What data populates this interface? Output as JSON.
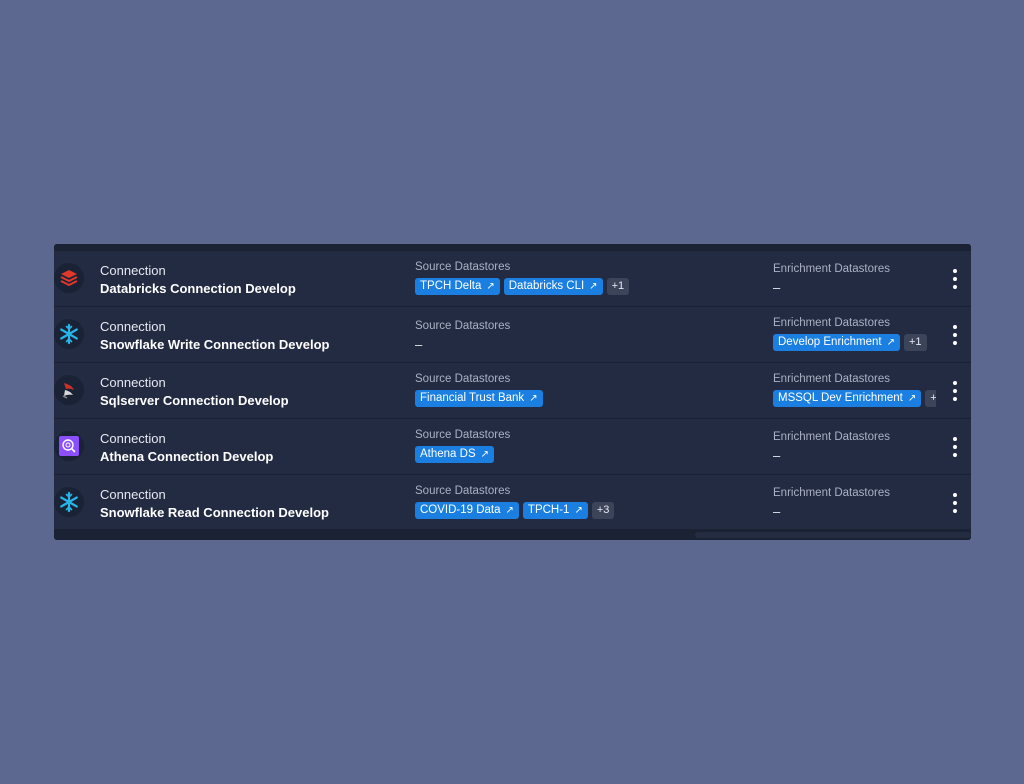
{
  "rows": [
    {
      "logo": "databricks-logo",
      "type": "Connection",
      "name": "Databricks Connection Develop",
      "source_label": "Source Datastores",
      "sources": [
        "TPCH Delta",
        "Databricks CLI"
      ],
      "sources_more": "+1",
      "enrichment_label": "Enrichment Datastores",
      "enrichment_empty": "–"
    },
    {
      "logo": "snowflake-logo",
      "type": "Connection",
      "name": "Snowflake Write Connection Develop",
      "source_label": "Source Datastores",
      "source_empty": "–",
      "enrichment_label": "Enrichment Datastores",
      "enrichments": [
        "Develop Enrichment"
      ],
      "enrichments_more": "+1"
    },
    {
      "logo": "sqlserver-logo",
      "type": "Connection",
      "name": "Sqlserver Connection Develop",
      "source_label": "Source Datastores",
      "sources": [
        "Financial Trust Bank"
      ],
      "enrichment_label": "Enrichment Datastores",
      "enrichments": [
        "MSSQL Dev Enrichment"
      ],
      "enrichments_more": "+"
    },
    {
      "logo": "athena-logo",
      "type": "Connection",
      "name": "Athena Connection Develop",
      "source_label": "Source Datastores",
      "sources": [
        "Athena DS"
      ],
      "enrichment_label": "Enrichment Datastores",
      "enrichment_empty": "–"
    },
    {
      "logo": "snowflake-logo",
      "type": "Connection",
      "name": "Snowflake Read Connection Develop",
      "source_label": "Source Datastores",
      "sources": [
        "COVID-19 Data",
        "TPCH-1"
      ],
      "sources_more": "+3",
      "enrichment_label": "Enrichment Datastores",
      "enrichment_empty": "–"
    }
  ],
  "colors": {
    "background": "#5c6890",
    "panel": "#232b42",
    "chip": "#1a7fe0",
    "databricks": "#e0382a",
    "snowflake": "#29b5e8",
    "athena": "#8c4fff"
  }
}
